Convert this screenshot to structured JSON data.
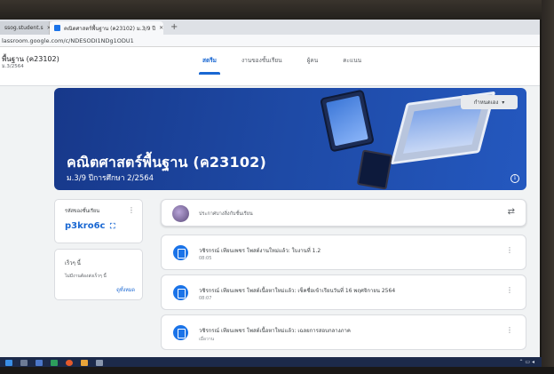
{
  "browser": {
    "tabs": [
      {
        "label": "ssog.student.s",
        "active": false
      },
      {
        "label": "คณิตศาสตร์พื้นฐาน (ค23102) ม.3/9 ปี",
        "active": true
      }
    ],
    "new_tab": "+",
    "url": "lassroom.google.com/c/NDESODI1NDg1ODU1"
  },
  "header": {
    "course_title": "พื้นฐาน (ค23102)",
    "course_sub": "ม.3/2564",
    "tabs": [
      {
        "label": "สตรีม",
        "selected": true
      },
      {
        "label": "งานของชั้นเรียน",
        "selected": false
      },
      {
        "label": "ผู้คน",
        "selected": false
      },
      {
        "label": "คะแนน",
        "selected": false
      }
    ]
  },
  "banner": {
    "title": "คณิตศาสตร์พื้นฐาน (ค23102)",
    "subtitle": "ม.3/9 ปีการศึกษา 2/2564",
    "customize_label": "กำหนดเอง",
    "info_glyph": "i"
  },
  "class_code": {
    "label": "รหัสของชั้นเรียน",
    "code": "p3kro6c",
    "fullscreen_glyph": "⛶"
  },
  "due": {
    "heading": "เร็วๆ นี้",
    "text": "ไม่มีงานต้องส่งเร็วๆ นี้",
    "link": "ดูทั้งหมด"
  },
  "announce": {
    "placeholder": "ประกาศบางสิ่งกับชั้นเรียน"
  },
  "posts": [
    {
      "title": "วชิรกรณ์ เทียนเพชร โพสต์งานใหม่แล้ว: ใบงานที่ 1.2",
      "date": "08:05"
    },
    {
      "title": "วชิรกรณ์ เทียนเพชร โพสต์เนื้อหาใหม่แล้ว: เช็คชื่อเข้าเรียนวันที่ 16 พฤศจิกายน 2564",
      "date": "08:07"
    },
    {
      "title": "วชิรกรณ์ เทียนเพชร โพสต์เนื้อหาใหม่แล้ว: เฉลยการสอบกลางภาค",
      "date": "เมื่อวาน"
    }
  ],
  "colors": {
    "accent": "#1967d2",
    "banner": "#1e4aa6",
    "taskbar": "#1c2a4a"
  }
}
